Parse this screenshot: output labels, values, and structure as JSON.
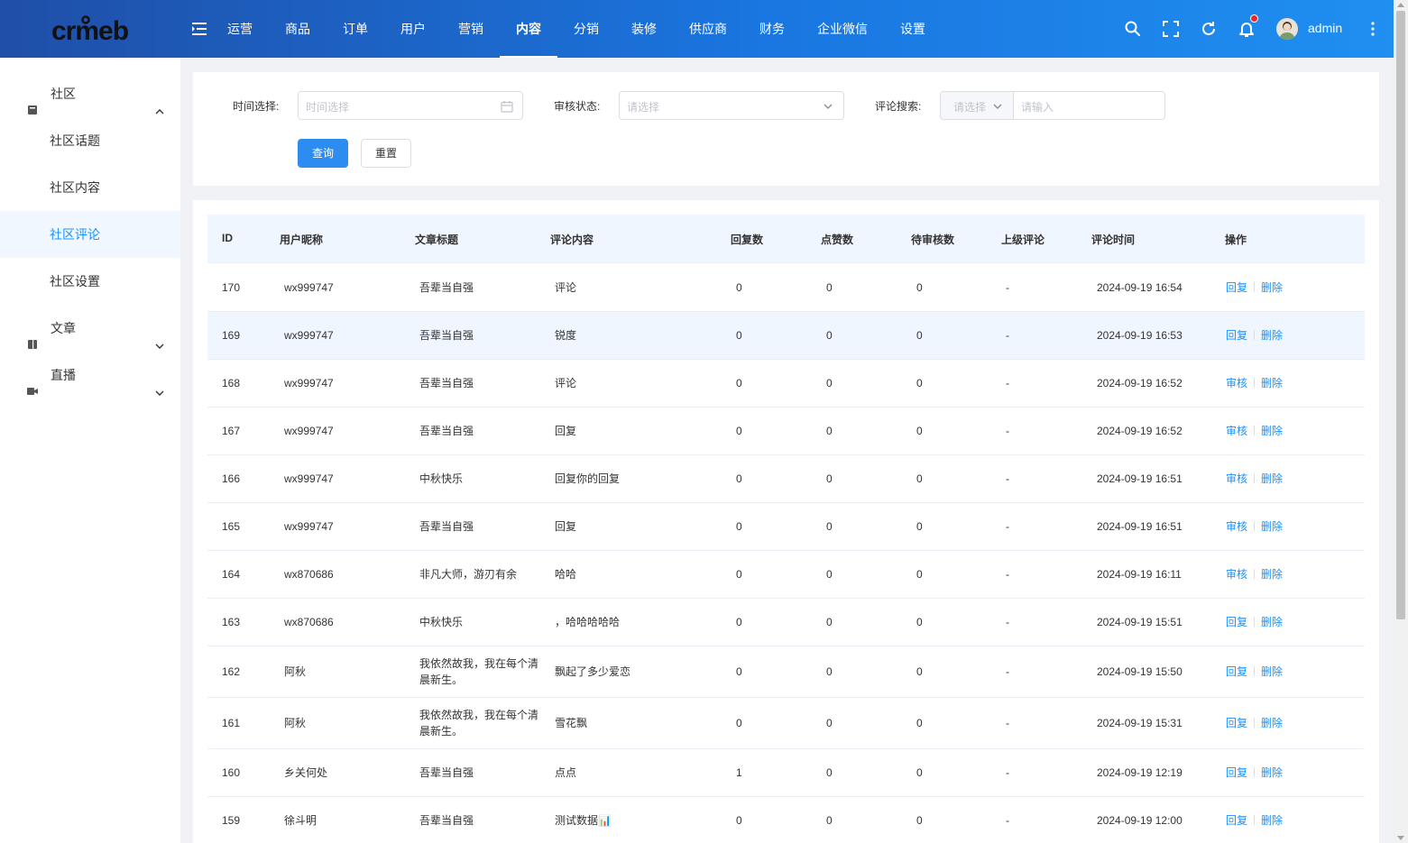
{
  "header": {
    "logo_text": "crmeb",
    "nav": [
      {
        "label": "运营",
        "active": false
      },
      {
        "label": "商品",
        "active": false
      },
      {
        "label": "订单",
        "active": false
      },
      {
        "label": "用户",
        "active": false
      },
      {
        "label": "营销",
        "active": false
      },
      {
        "label": "内容",
        "active": true
      },
      {
        "label": "分销",
        "active": false
      },
      {
        "label": "装修",
        "active": false
      },
      {
        "label": "供应商",
        "active": false
      },
      {
        "label": "财务",
        "active": false
      },
      {
        "label": "企业微信",
        "active": false
      },
      {
        "label": "设置",
        "active": false
      }
    ],
    "username": "admin",
    "colors": {
      "gradient_start": "#1f4fa8",
      "gradient_end": "#1f8ff0",
      "notification_dot": "#f5222d"
    }
  },
  "sidebar": {
    "groups": [
      {
        "label": "社区",
        "icon": "community-icon",
        "expanded": true,
        "items": [
          {
            "label": "社区话题",
            "active": false
          },
          {
            "label": "社区内容",
            "active": false
          },
          {
            "label": "社区评论",
            "active": true
          },
          {
            "label": "社区设置",
            "active": false
          }
        ]
      },
      {
        "label": "文章",
        "icon": "article-icon",
        "expanded": false
      },
      {
        "label": "直播",
        "icon": "live-icon",
        "expanded": false
      }
    ],
    "active_color": "#1890ff"
  },
  "search": {
    "time_label": "时间选择:",
    "time_placeholder": "时间选择",
    "status_label": "审核状态:",
    "status_placeholder": "请选择",
    "comment_label": "评论搜索:",
    "comment_type_placeholder": "请选择",
    "comment_input_placeholder": "请输入",
    "query_button": "查询",
    "reset_button": "重置"
  },
  "table": {
    "columns": [
      "ID",
      "用户昵称",
      "文章标题",
      "评论内容",
      "回复数",
      "点赞数",
      "待审核数",
      "上级评论",
      "评论时间",
      "操作"
    ],
    "rows": [
      {
        "id": "170",
        "nickname": "wx999747",
        "title": "吾辈当自强",
        "content": "评论",
        "replies": "0",
        "likes": "0",
        "pending": "0",
        "parent": "-",
        "time": "2024-09-19 16:54",
        "action": "回复",
        "delete": "删除"
      },
      {
        "id": "169",
        "nickname": "wx999747",
        "title": "吾辈当自强",
        "content": "锐度",
        "replies": "0",
        "likes": "0",
        "pending": "0",
        "parent": "-",
        "time": "2024-09-19 16:53",
        "action": "回复",
        "delete": "删除"
      },
      {
        "id": "168",
        "nickname": "wx999747",
        "title": "吾辈当自强",
        "content": "评论",
        "replies": "0",
        "likes": "0",
        "pending": "0",
        "parent": "-",
        "time": "2024-09-19 16:52",
        "action": "审核",
        "delete": "删除"
      },
      {
        "id": "167",
        "nickname": "wx999747",
        "title": "吾辈当自强",
        "content": "回复",
        "replies": "0",
        "likes": "0",
        "pending": "0",
        "parent": "-",
        "time": "2024-09-19 16:52",
        "action": "审核",
        "delete": "删除"
      },
      {
        "id": "166",
        "nickname": "wx999747",
        "title": "中秋快乐",
        "content": "回复你的回复",
        "replies": "0",
        "likes": "0",
        "pending": "0",
        "parent": "-",
        "time": "2024-09-19 16:51",
        "action": "审核",
        "delete": "删除"
      },
      {
        "id": "165",
        "nickname": "wx999747",
        "title": "吾辈当自强",
        "content": "回复",
        "replies": "0",
        "likes": "0",
        "pending": "0",
        "parent": "-",
        "time": "2024-09-19 16:51",
        "action": "审核",
        "delete": "删除"
      },
      {
        "id": "164",
        "nickname": "wx870686",
        "title": "非凡大师，游刃有余",
        "content": "哈哈",
        "replies": "0",
        "likes": "0",
        "pending": "0",
        "parent": "-",
        "time": "2024-09-19 16:11",
        "action": "审核",
        "delete": "删除"
      },
      {
        "id": "163",
        "nickname": "wx870686",
        "title": "中秋快乐",
        "content": "，哈哈哈哈哈",
        "replies": "0",
        "likes": "0",
        "pending": "0",
        "parent": "-",
        "time": "2024-09-19 15:51",
        "action": "回复",
        "delete": "删除"
      },
      {
        "id": "162",
        "nickname": "阿秋",
        "title": "我依然故我，我在每个清晨新生。",
        "content": "飘起了多少爱恋",
        "replies": "0",
        "likes": "0",
        "pending": "0",
        "parent": "-",
        "time": "2024-09-19 15:50",
        "action": "回复",
        "delete": "删除"
      },
      {
        "id": "161",
        "nickname": "阿秋",
        "title": "我依然故我，我在每个清晨新生。",
        "content": "雪花飘",
        "replies": "0",
        "likes": "0",
        "pending": "0",
        "parent": "-",
        "time": "2024-09-19 15:31",
        "action": "回复",
        "delete": "删除"
      },
      {
        "id": "160",
        "nickname": "乡关何处",
        "title": "吾辈当自强",
        "content": "点点",
        "replies": "1",
        "likes": "0",
        "pending": "0",
        "parent": "-",
        "time": "2024-09-19 12:19",
        "action": "回复",
        "delete": "删除"
      },
      {
        "id": "159",
        "nickname": "徐斗明",
        "title": "吾辈当自强",
        "content": "测试数据📊",
        "replies": "0",
        "likes": "0",
        "pending": "0",
        "parent": "-",
        "time": "2024-09-19 12:00",
        "action": "回复",
        "delete": "删除"
      }
    ]
  }
}
